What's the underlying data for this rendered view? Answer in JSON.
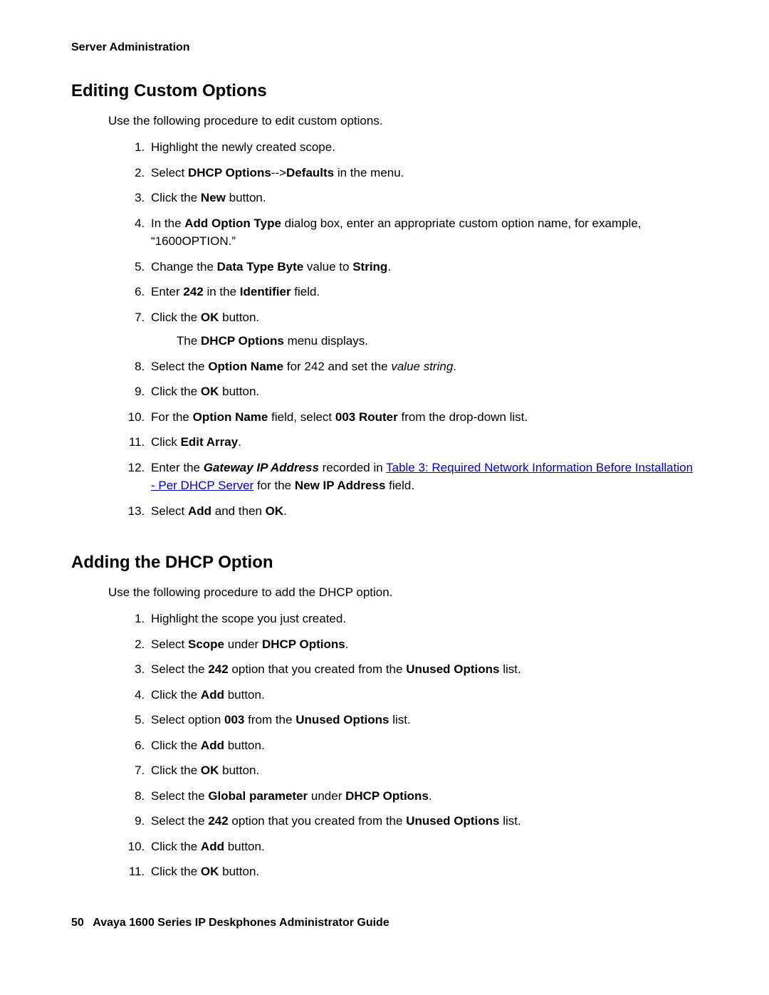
{
  "header": {
    "running": "Server Administration"
  },
  "sections": [
    {
      "heading": "Editing Custom Options",
      "intro": "Use the following procedure to edit custom options.",
      "steps": [
        {
          "html": "Highlight the newly created scope."
        },
        {
          "html": "Select <b>DHCP Options</b>--><b>Defaults</b> in the menu."
        },
        {
          "html": "Click the <b>New</b> button."
        },
        {
          "html": "In the <b>Add Option Type</b> dialog box, enter an appropriate custom option name, for example, “1600OPTION.”"
        },
        {
          "html": "Change the <b>Data Type Byte</b> value to <b>String</b>."
        },
        {
          "html": "Enter <b>242</b> in the <b>Identifier</b> field."
        },
        {
          "html": "Click the <b>OK</b> button.",
          "sub": "The <b>DHCP Options</b> menu displays."
        },
        {
          "html": "Select the <b>Option Name</b> for 242 and set the <em>value string</em>."
        },
        {
          "html": "Click the <b>OK</b> button."
        },
        {
          "html": "For the <b>Option Name</b> field, select <b>003 Router</b> from the drop-down list."
        },
        {
          "html": "Click <b>Edit Array</b>."
        },
        {
          "html": "Enter the <b><em>Gateway IP Address</em></b> recorded in <a class=\"xref\" data-name=\"link-table-3\" data-interactable=\"true\">Table 3:  Required Network Information Before Installation - Per DHCP Server</a> for the <b>New IP Address</b> field."
        },
        {
          "html": "Select <b>Add</b> and then <b>OK</b>."
        }
      ]
    },
    {
      "heading": "Adding the DHCP Option",
      "intro": "Use the following procedure to add the DHCP option.",
      "steps": [
        {
          "html": "Highlight the scope you just created."
        },
        {
          "html": "Select <b>Scope</b> under <b>DHCP Options</b>."
        },
        {
          "html": "Select the <b>242</b> option that you created from the <b>Unused Options</b> list."
        },
        {
          "html": "Click the <b>Add</b> button."
        },
        {
          "html": "Select option <b>003</b> from the <b>Unused Options</b> list."
        },
        {
          "html": "Click the <b>Add</b> button."
        },
        {
          "html": "Click the <b>OK</b> button."
        },
        {
          "html": "Select the <b>Global parameter</b> under <b>DHCP Options</b>."
        },
        {
          "html": "Select the <b>242</b> option that you created from the <b>Unused Options</b> list."
        },
        {
          "html": "Click the <b>Add</b> button."
        },
        {
          "html": "Click the <b>OK</b> button."
        }
      ]
    }
  ],
  "footer": {
    "page_number": "50",
    "book_title": "Avaya 1600 Series IP Deskphones Administrator Guide"
  }
}
